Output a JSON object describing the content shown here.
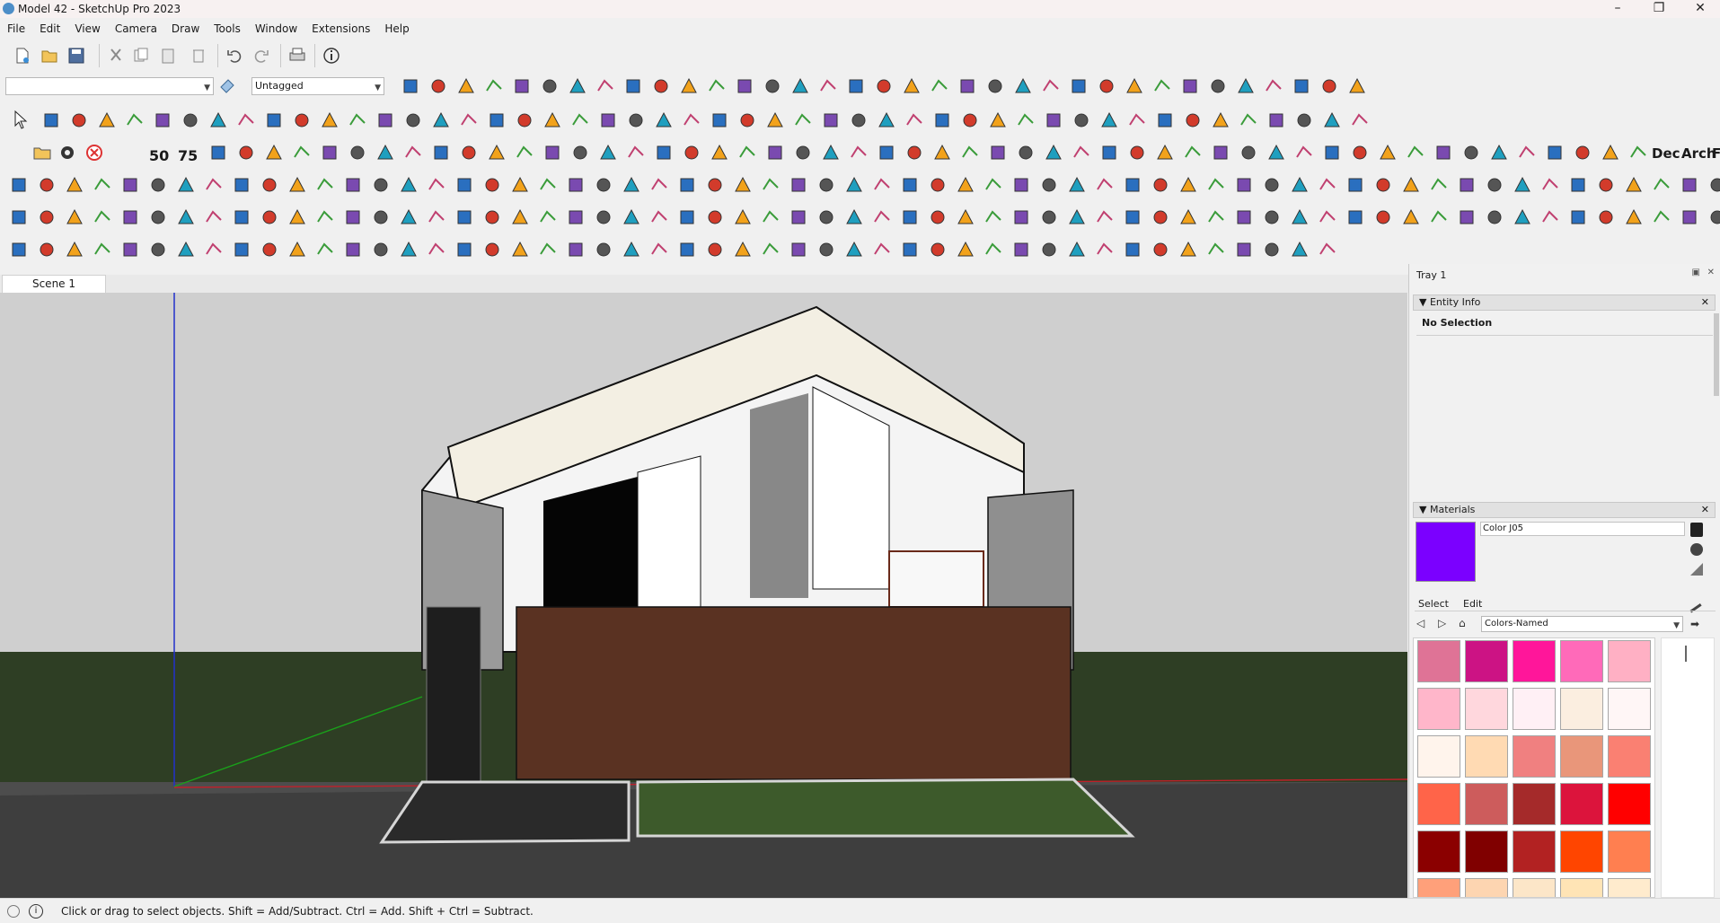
{
  "window": {
    "title": "Model 42 - SketchUp Pro 2023",
    "minimize": "–",
    "maximize": "❐",
    "close": "✕"
  },
  "menu": [
    "File",
    "Edit",
    "View",
    "Camera",
    "Draw",
    "Tools",
    "Window",
    "Extensions",
    "Help"
  ],
  "toolbar": {
    "layer_combo": {
      "value": ""
    },
    "tag_combo": {
      "value": "Untagged"
    },
    "row4_labels": {
      "dec": "Dec",
      "arch": "Arch",
      "f": "F"
    },
    "row3_numbers": {
      "fifty": "50",
      "seventy_five": "75"
    },
    "icon_colors": [
      "#2a6fbf",
      "#d23b2b",
      "#f2a21b",
      "#3a9c3a",
      "#7a4ab0",
      "#555555",
      "#1f9fbf",
      "#c04070"
    ]
  },
  "scenes": {
    "tabs": [
      "Scene 1"
    ]
  },
  "tray": {
    "title": "Tray 1",
    "entity_info": {
      "title": "Entity Info",
      "status": "No Selection"
    },
    "materials": {
      "title": "Materials",
      "current_name": "Color J05",
      "current_color": "#7b00ff",
      "tabs": {
        "select": "Select",
        "edit": "Edit"
      },
      "library": "Colors-Named",
      "swatches": [
        [
          "#df7396",
          "#cc1384",
          "#ff169a",
          "#ff6ab9",
          "#ffb0c4"
        ],
        [
          "#ffb6ca",
          "#ffd7dd",
          "#fff0f5",
          "#fbeee0",
          "#fff6f6"
        ],
        [
          "#fff4ec",
          "#ffdab3",
          "#f08080",
          "#e9967a",
          "#fa8072"
        ],
        [
          "#ff6449",
          "#cd5c5c",
          "#a52a2a",
          "#dc143c",
          "#ff0000"
        ],
        [
          "#8b0000",
          "#800000",
          "#b22222",
          "#ff4500",
          "#ff7f50"
        ],
        [
          "#ffa07a",
          "#fdd5b1",
          "#fce6c8",
          "#ffe4b5",
          "#ffebcd"
        ]
      ]
    }
  },
  "status": {
    "text": "Click or drag to select objects. Shift = Add/Subtract. Ctrl = Add. Shift + Ctrl = Subtract."
  }
}
